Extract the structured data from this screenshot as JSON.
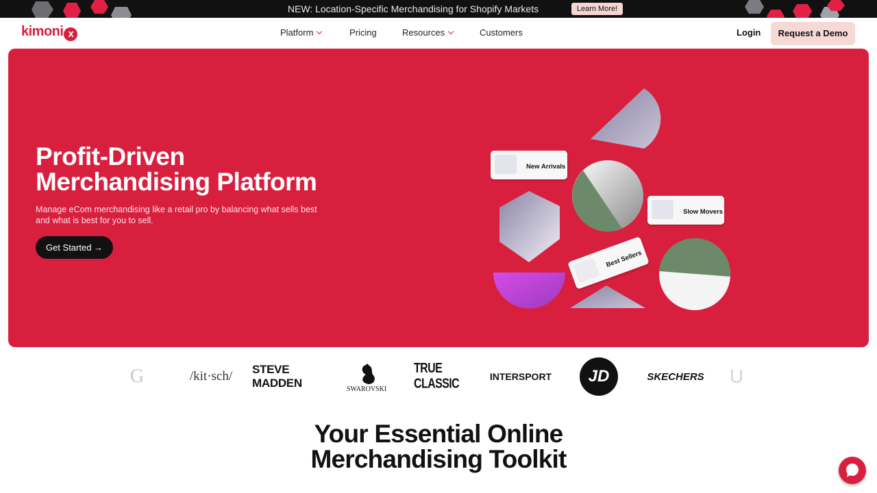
{
  "announcement": {
    "text": "NEW: Location-Specific Merchandising for Shopify Markets",
    "button_label": "Learn More!"
  },
  "header": {
    "logo_text": "kimoni",
    "logo_mark": "x",
    "nav": [
      {
        "label": "Platform",
        "has_dropdown": true
      },
      {
        "label": "Pricing",
        "has_dropdown": false
      },
      {
        "label": "Resources",
        "has_dropdown": true
      },
      {
        "label": "Customers",
        "has_dropdown": false
      }
    ],
    "login_label": "Login",
    "demo_label": "Request a Demo"
  },
  "hero": {
    "title_line1": "Profit-Driven",
    "title_line2": "Merchandising Platform",
    "subtitle": "Manage eCom merchandising like a retail pro by balancing what sells best and what is best for you to sell.",
    "cta_label": "Get Started →",
    "tags": {
      "new_arrivals": "New Arrivals",
      "slow_movers": "Slow Movers",
      "best_sellers": "Best Sellers"
    }
  },
  "brands": [
    "G",
    "/kit·sch/",
    "STEVE MADDEN",
    "SWAROVSKI",
    "TRUE CLASSIC",
    "INTERSPORT",
    "JD",
    "SKECHERS",
    "U"
  ],
  "section": {
    "title_line1": "Your Essential Online",
    "title_line2": "Merchandising Toolkit"
  },
  "colors": {
    "brand_red": "#d81f3e",
    "demo_bg": "#f6d8d5",
    "dark": "#111111"
  },
  "icons": {
    "chat": "chat-bubble-icon",
    "dropdown": "chevron-down-icon"
  }
}
